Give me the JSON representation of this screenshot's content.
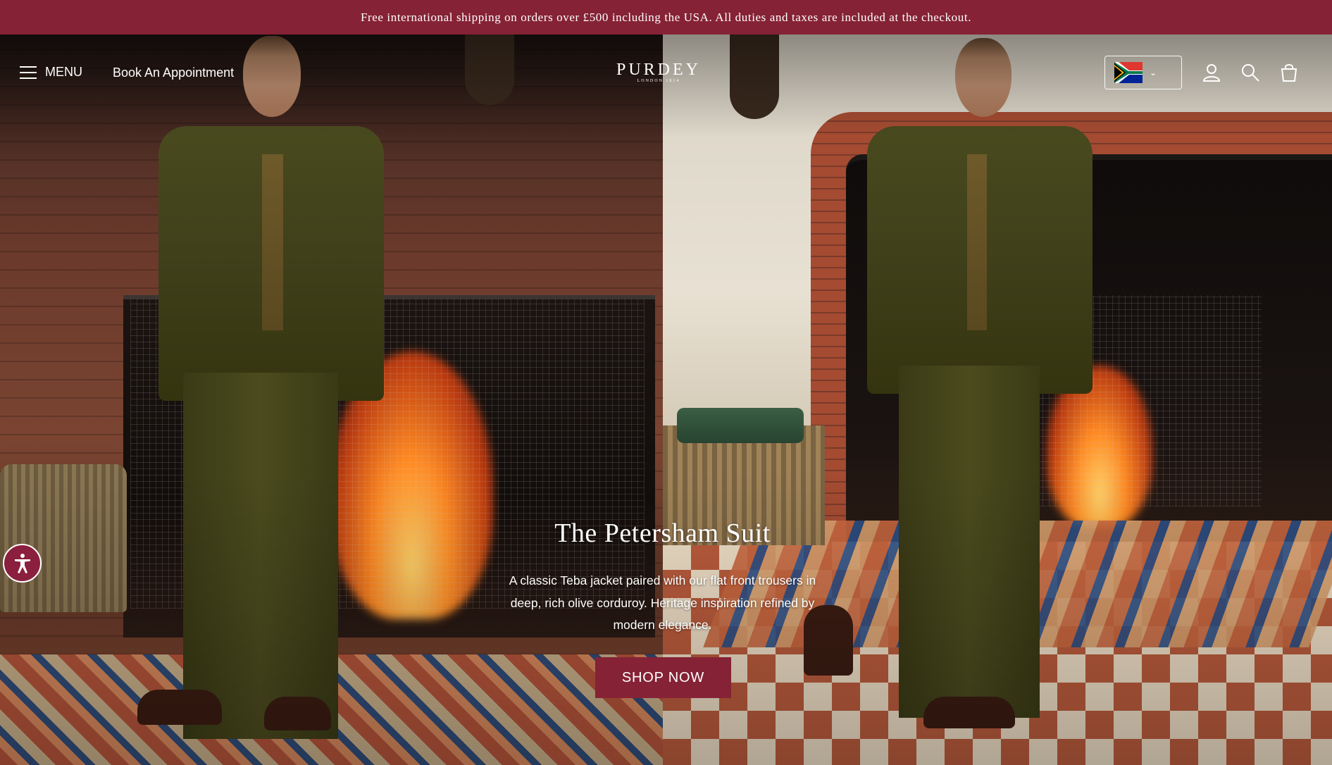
{
  "announcement": {
    "text": "Free international shipping on orders over £500 including the USA. All duties and taxes are included at the checkout.",
    "bg_color": "#852235"
  },
  "header": {
    "menu_label": "MENU",
    "appointment_label": "Book An Appointment",
    "logo": {
      "name": "PURDEY",
      "tagline": "LONDON 1814"
    },
    "country_selector": {
      "flag": "south-africa-flag",
      "icon": "chevron-down-icon"
    },
    "icons": [
      "account-icon",
      "search-icon",
      "cart-icon"
    ]
  },
  "hero": {
    "title": "The Petersham Suit",
    "description": "A classic Teba jacket paired with our flat front trousers in deep, rich olive corduroy. Heritage inspiration refined by modern elegance.",
    "cta_label": "SHOP NOW",
    "cta_color": "#852235"
  },
  "accessibility": {
    "icon": "accessibility-icon",
    "color": "#8b1f3e"
  }
}
